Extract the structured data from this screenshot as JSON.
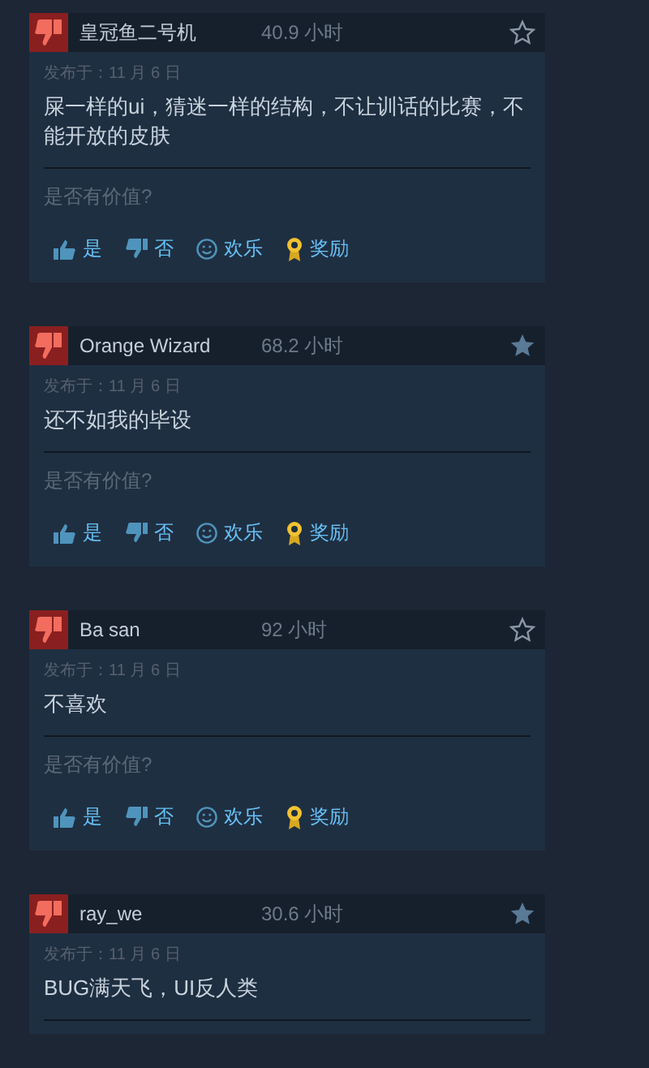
{
  "reviews": [
    {
      "author": "皇冠鱼二号机",
      "hours": "40.9 小时",
      "starred": false,
      "posted": "发布于：11 月 6 日",
      "text": "屎一样的ui，猜迷一样的结构，不让训话的比赛，不能开放的皮肤",
      "helpful_prompt": "是否有价值?",
      "actions": [
        {
          "kind": "yes",
          "label": "是"
        },
        {
          "kind": "no",
          "label": "否"
        },
        {
          "kind": "funny",
          "label": "欢乐"
        },
        {
          "kind": "award",
          "label": "奖励"
        }
      ]
    },
    {
      "author": "Orange Wizard",
      "hours": "68.2 小时",
      "starred": true,
      "posted": "发布于：11 月 6 日",
      "text": "还不如我的毕设",
      "helpful_prompt": "是否有价值?",
      "actions": [
        {
          "kind": "yes",
          "label": "是"
        },
        {
          "kind": "no",
          "label": "否"
        },
        {
          "kind": "funny",
          "label": "欢乐"
        },
        {
          "kind": "award",
          "label": "奖励"
        }
      ]
    },
    {
      "author": "Ba san",
      "hours": "92 小时",
      "starred": false,
      "posted": "发布于：11 月 6 日",
      "text": "不喜欢",
      "helpful_prompt": "是否有价值?",
      "actions": [
        {
          "kind": "yes",
          "label": "是"
        },
        {
          "kind": "no",
          "label": "否"
        },
        {
          "kind": "funny",
          "label": "欢乐"
        },
        {
          "kind": "award",
          "label": "奖励"
        }
      ]
    },
    {
      "author": "ray_we",
      "hours": "30.6 小时",
      "starred": true,
      "posted": "发布于：11 月 6 日",
      "text": "BUG满天飞，UI反人类"
    }
  ]
}
